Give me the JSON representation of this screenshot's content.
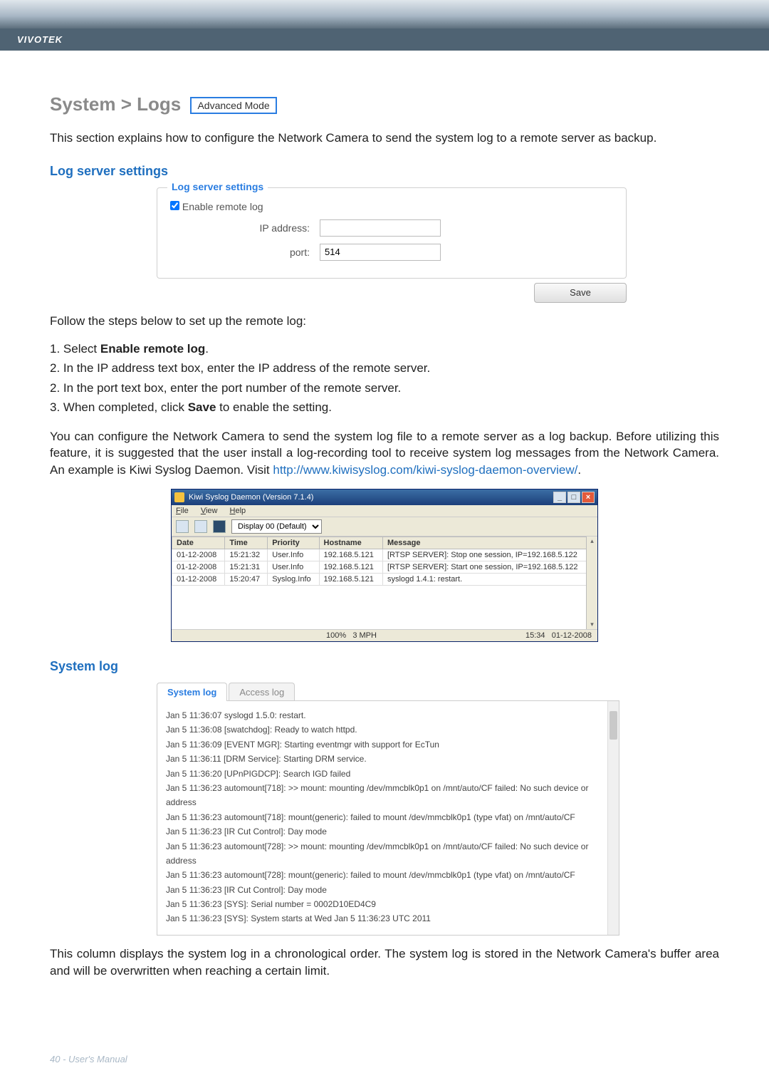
{
  "brand": "VIVOTEK",
  "heading": {
    "prefix": "System > Logs",
    "badge": "Advanced Mode"
  },
  "intro": "This section explains how to configure the Network Camera to send the system log to a remote server as backup.",
  "section_log_server": "Log server settings",
  "panel": {
    "title": "Log server settings",
    "enable_label": "Enable remote log",
    "ip_label": "IP address:",
    "ip_value": "",
    "port_label": "port:",
    "port_value": "514",
    "save_label": "Save"
  },
  "follow_steps_intro": "Follow the steps below to set up the remote log:",
  "steps": [
    "1. Select Enable remote log.",
    "2. In the IP address text box, enter the IP address of the remote server.",
    "2. In the port text box, enter the port number of the remote server.",
    "3. When completed, click Save to enable the setting."
  ],
  "para_backup": {
    "text": "You can configure the Network Camera to send the system log file to a remote server as a log backup. Before utilizing this feature, it is suggested that the user install a log-recording tool to receive system log messages from the Network Camera. An example is Kiwi Syslog Daemon. Visit ",
    "link": "http://www.kiwisyslog.com/kiwi-syslog-daemon-overview/",
    "suffix": "."
  },
  "kiwi": {
    "title": "Kiwi Syslog Daemon (Version 7.1.4)",
    "menu": {
      "file": "File",
      "view": "View",
      "help": "Help"
    },
    "display_label": "Display 00 (Default)",
    "columns": [
      "Date",
      "Time",
      "Priority",
      "Hostname",
      "Message"
    ],
    "rows": [
      [
        "01-12-2008",
        "15:21:32",
        "User.Info",
        "192.168.5.121",
        "[RTSP SERVER]: Stop one session, IP=192.168.5.122"
      ],
      [
        "01-12-2008",
        "15:21:31",
        "User.Info",
        "192.168.5.121",
        "[RTSP SERVER]: Start one session, IP=192.168.5.122"
      ],
      [
        "01-12-2008",
        "15:20:47",
        "Syslog.Info",
        "192.168.5.121",
        "syslogd 1.4.1: restart."
      ]
    ],
    "status": {
      "pct": "100%",
      "rate": "3 MPH",
      "time": "15:34",
      "date": "01-12-2008"
    }
  },
  "section_system_log": "System log",
  "syslog_tabs": {
    "system": "System log",
    "access": "Access log"
  },
  "syslog_lines": [
    "Jan 5 11:36:07 syslogd 1.5.0: restart.",
    "Jan 5 11:36:08 [swatchdog]: Ready to watch httpd.",
    "Jan 5 11:36:09 [EVENT MGR]: Starting eventmgr with support for EcTun",
    "Jan 5 11:36:11 [DRM Service]: Starting DRM service.",
    "Jan 5 11:36:20 [UPnPIGDCP]: Search IGD failed",
    "Jan 5 11:36:23 automount[718]: >> mount: mounting /dev/mmcblk0p1 on /mnt/auto/CF failed: No such device or address",
    "Jan 5 11:36:23 automount[718]: mount(generic): failed to mount /dev/mmcblk0p1 (type vfat) on /mnt/auto/CF",
    "Jan 5 11:36:23 [IR Cut Control]: Day mode",
    "Jan 5 11:36:23 automount[728]: >> mount: mounting /dev/mmcblk0p1 on /mnt/auto/CF failed: No such device or address",
    "Jan 5 11:36:23 automount[728]: mount(generic): failed to mount /dev/mmcblk0p1 (type vfat) on /mnt/auto/CF",
    "Jan 5 11:36:23 [IR Cut Control]: Day mode",
    "Jan 5 11:36:23 [SYS]: Serial number = 0002D10ED4C9",
    "Jan 5 11:36:23 [SYS]: System starts at Wed Jan 5 11:36:23 UTC 2011"
  ],
  "syslog_para": "This column displays the system log in a chronological order. The system log is stored in the Network Camera's buffer area and will be overwritten when reaching a certain limit.",
  "footer": "40 - User's Manual"
}
